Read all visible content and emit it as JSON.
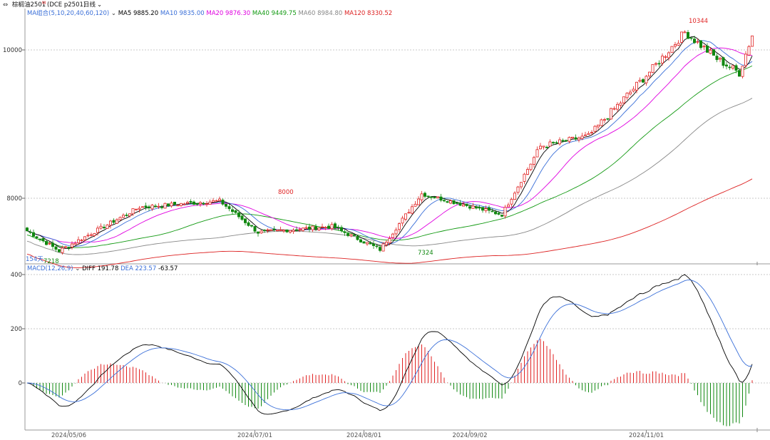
{
  "header": {
    "icon": "double-arrow-icon",
    "instrument": "棕榈油2501",
    "instrument_sup": "M",
    "instrument_code": "(DCE p2501)",
    "period": "日线",
    "period_arrow": "chevron-down-icon"
  },
  "ma_legend": {
    "group_label": "MA组合(5,10,20,40,60,120)",
    "group_arrow": "chevron-down-icon",
    "items": [
      {
        "label": "MA5 9885.20",
        "color": "#000000"
      },
      {
        "label": "MA10 9835.00",
        "color": "#3a6fd8"
      },
      {
        "label": "MA20 9876.30",
        "color": "#e000e0"
      },
      {
        "label": "MA40 9449.75",
        "color": "#119911"
      },
      {
        "label": "MA60 8984.80",
        "color": "#888888"
      },
      {
        "label": "MA120 8330.52",
        "color": "#dd2222"
      }
    ]
  },
  "macd_legend": {
    "group_label": "MACD(12,26,9)",
    "group_arrow": "chevron-down-icon",
    "items": [
      {
        "label": "DIFF 191.78",
        "color": "#000000"
      },
      {
        "label": "DEA 223.57",
        "color": "#3a6fd8"
      },
      {
        "label": "-63.57",
        "color": "#000000"
      }
    ]
  },
  "annotations": {
    "high1": "8000",
    "low_start": "7218",
    "low_start_prefix": "154天",
    "low_mid": "7324",
    "high_peak": "10344"
  },
  "dates": [
    "2024/05/06",
    "2024/07/01",
    "2024/08/01",
    "2024/09/02",
    "2024/11/01"
  ],
  "colors": {
    "up": "#e02222",
    "down": "#118811",
    "grid": "#c8c8c8"
  },
  "chart_data": [
    {
      "type": "candlestick",
      "title": "",
      "y_ticks": [
        8000,
        10000
      ],
      "ylim": [
        7100,
        10350
      ],
      "grid": true,
      "annotated_extremes": {
        "high": 10344,
        "low": 7218,
        "local_high": 8000,
        "local_low": 7324
      },
      "key_prices": [
        {
          "date_index": 0,
          "close": 7560
        },
        {
          "date_index": 10,
          "close": 7290
        },
        {
          "date_index": 35,
          "close": 7880
        },
        {
          "date_index": 60,
          "close": 7965
        },
        {
          "date_index": 72,
          "close": 7540
        },
        {
          "date_index": 95,
          "close": 7620
        },
        {
          "date_index": 110,
          "close": 7310
        },
        {
          "date_index": 123,
          "close": 8060
        },
        {
          "date_index": 148,
          "close": 7780
        },
        {
          "date_index": 160,
          "close": 8700
        },
        {
          "date_index": 175,
          "close": 8840
        },
        {
          "date_index": 195,
          "close": 9750
        },
        {
          "date_index": 205,
          "close": 10240
        },
        {
          "date_index": 215,
          "close": 9880
        },
        {
          "date_index": 222,
          "close": 9690
        },
        {
          "date_index": 226,
          "close": 10200
        }
      ],
      "ma_last": {
        "MA5": 9885.2,
        "MA10": 9835.0,
        "MA20": 9876.3,
        "MA40": 9449.75,
        "MA60": 8984.8,
        "MA120": 8330.52
      }
    },
    {
      "type": "line",
      "title": "",
      "y_ticks": [
        0,
        200,
        400
      ],
      "ylim": [
        -170,
        410
      ],
      "series": [
        {
          "name": "DIFF",
          "last": 191.78
        },
        {
          "name": "DEA",
          "last": 223.57
        },
        {
          "name": "MACD",
          "last": -63.57
        }
      ]
    }
  ]
}
